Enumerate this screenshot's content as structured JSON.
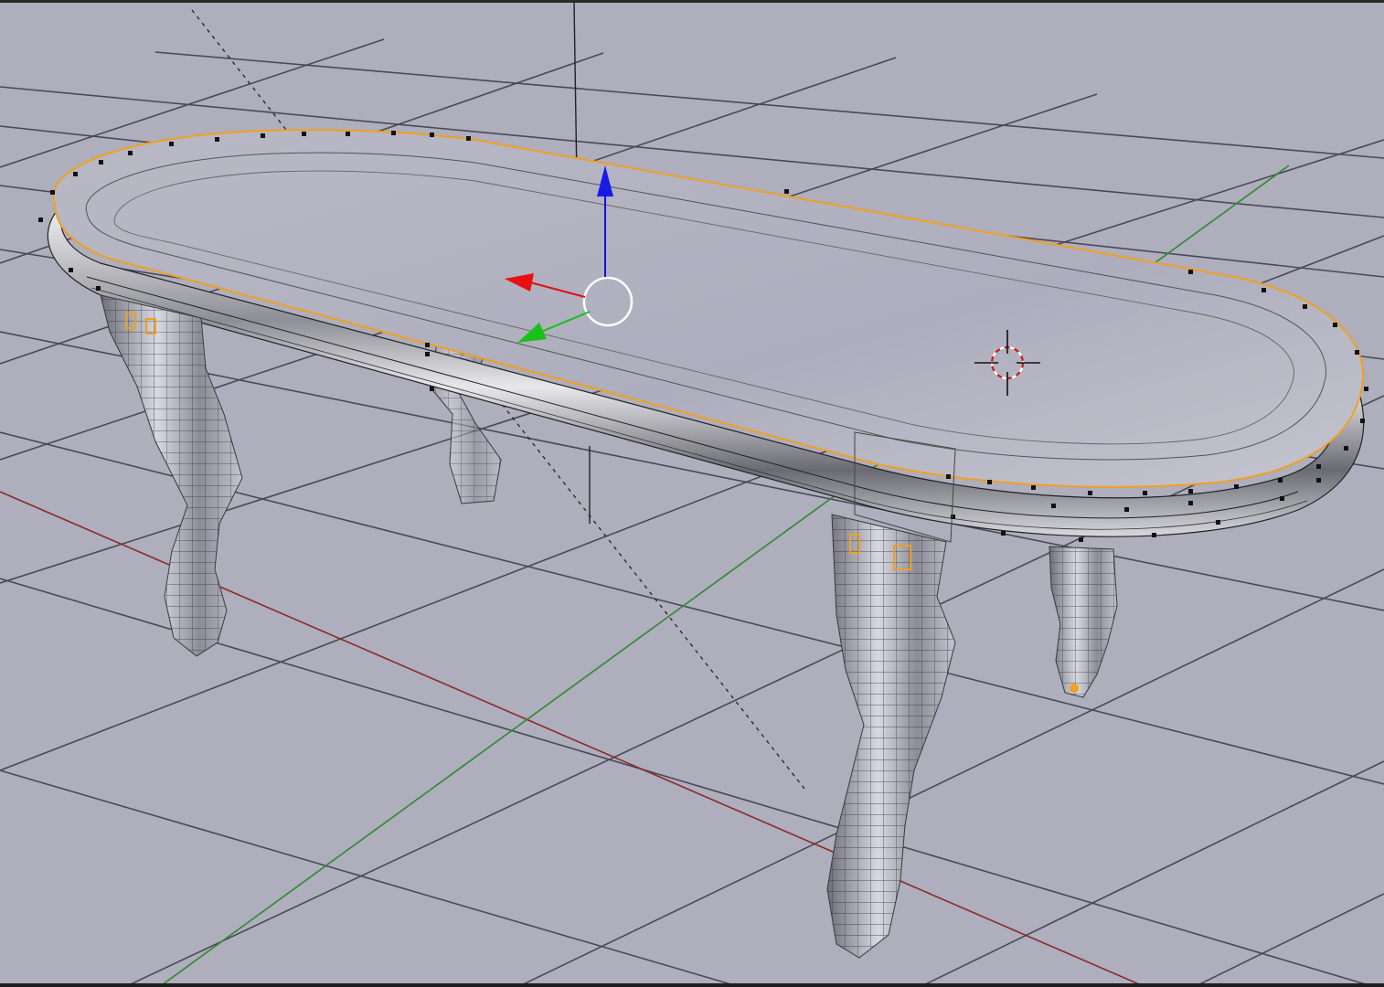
{
  "viewport": {
    "background_color": "#aeaebd",
    "grid_color": "#4a4a56",
    "x_axis_color": "#8c2a2a",
    "y_axis_color": "#2f8a2f",
    "selection_outline_color": "#f0a020",
    "mesh_color": "#c8c8d0"
  },
  "scene": {
    "object": "table",
    "legs": 4,
    "mode": "edit-mode-wireframe"
  },
  "manipulator": {
    "x_axis_color": "#e01010",
    "y_axis_color": "#18c018",
    "z_axis_color": "#1010e0"
  },
  "cursor_3d": {
    "color": "#d01818"
  }
}
